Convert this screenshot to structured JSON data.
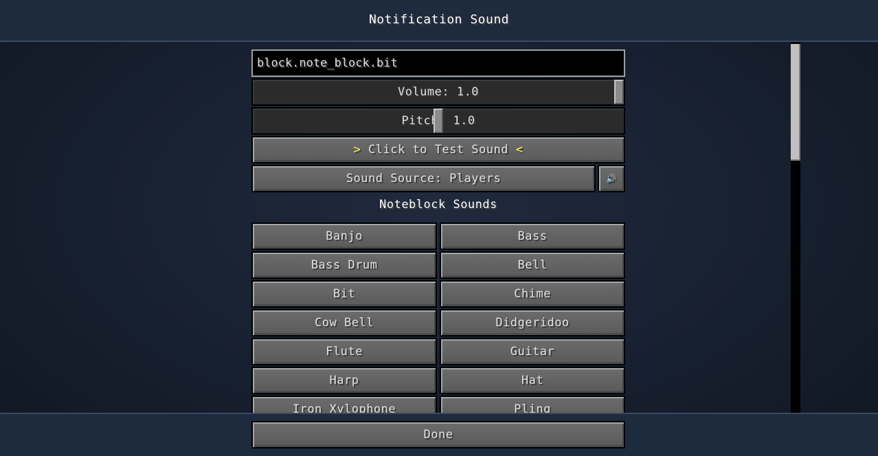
{
  "header": {
    "title": "Notification Sound"
  },
  "sound_field": {
    "value": "block.note_block.bit"
  },
  "volume": {
    "label": "Volume: 1.0",
    "value": 1.0
  },
  "pitch": {
    "label": "Pitch: 1.0",
    "value": 1.0
  },
  "test_button": {
    "arrow_left": ">",
    "label": " Click to Test Sound ",
    "arrow_right": "<"
  },
  "source_button": {
    "label": "Sound Source: Players",
    "icon": "speaker-icon",
    "icon_glyph": "🔊"
  },
  "section": {
    "label": "Noteblock Sounds"
  },
  "sounds": [
    "Banjo",
    "Bass",
    "Bass Drum",
    "Bell",
    "Bit",
    "Chime",
    "Cow Bell",
    "Didgeridoo",
    "Flute",
    "Guitar",
    "Harp",
    "Hat",
    "Iron Xylophone",
    "Pling"
  ],
  "footer": {
    "done_label": "Done"
  },
  "colors": {
    "accent_arrow": "#ffff55",
    "background": "#172030",
    "header": "#1e2a3d"
  }
}
